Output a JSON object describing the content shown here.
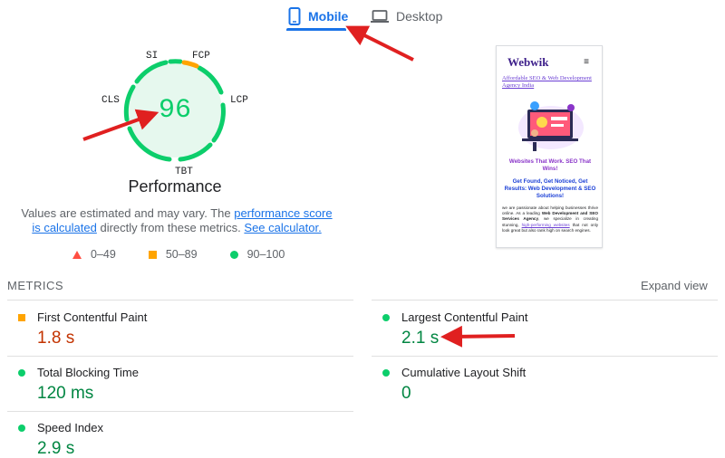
{
  "tabs": [
    {
      "label": "Mobile",
      "icon": "smartphone-icon",
      "active": true
    },
    {
      "label": "Desktop",
      "icon": "laptop-icon",
      "active": false
    }
  ],
  "gauge": {
    "score": "96",
    "title": "Performance",
    "score_color": "#0cce6b",
    "labels": {
      "si": "SI",
      "fcp": "FCP",
      "lcp": "LCP",
      "tbt": "TBT",
      "cls": "CLS"
    }
  },
  "description": {
    "prefix": "Values are estimated and may vary. The ",
    "link1": "performance score is calculated",
    "middle": " directly from these metrics. ",
    "link2": "See calculator."
  },
  "legend": [
    {
      "icon": "red-triangle-icon",
      "label": "0–49",
      "color": "#ff4e42"
    },
    {
      "icon": "orange-square-icon",
      "label": "50–89",
      "color": "#ffa400"
    },
    {
      "icon": "green-circle-icon",
      "label": "90–100",
      "color": "#0cce6b"
    }
  ],
  "screenshot": {
    "logo": "Webwik",
    "menu": "≡",
    "link": "Affordable SEO & Web Development Agency India",
    "heading1": "Websites That Work. SEO That Wins!",
    "heading2": "Get Found, Get Noticed, Get Results: Web Development & SEO Solutions!",
    "body_start": "we are passionate about helping businesses thrive online. As a leading ",
    "body_bold": "Web Development and SEO Services Agency",
    "body_mid": ", we specialize in creating stunning, ",
    "body_link": "high-performing websites",
    "body_end": " that not only look great but also rank high on search engines."
  },
  "metrics": {
    "heading": "METRICS",
    "expand_label": "Expand view",
    "items": [
      {
        "name": "First Contentful Paint",
        "value": "1.8 s",
        "status": "average",
        "color": "#c33300"
      },
      {
        "name": "Largest Contentful Paint",
        "value": "2.1 s",
        "status": "good",
        "color": "#018642"
      },
      {
        "name": "Total Blocking Time",
        "value": "120 ms",
        "status": "good",
        "color": "#018642"
      },
      {
        "name": "Cumulative Layout Shift",
        "value": "0",
        "status": "good",
        "color": "#018642"
      },
      {
        "name": "Speed Index",
        "value": "2.9 s",
        "status": "good",
        "color": "#018642"
      }
    ]
  },
  "colors": {
    "accent": "#1a73e8",
    "good": "#0cce6b",
    "average": "#ffa400",
    "poor": "#ff4e42",
    "annotation_arrow": "#e02020"
  }
}
